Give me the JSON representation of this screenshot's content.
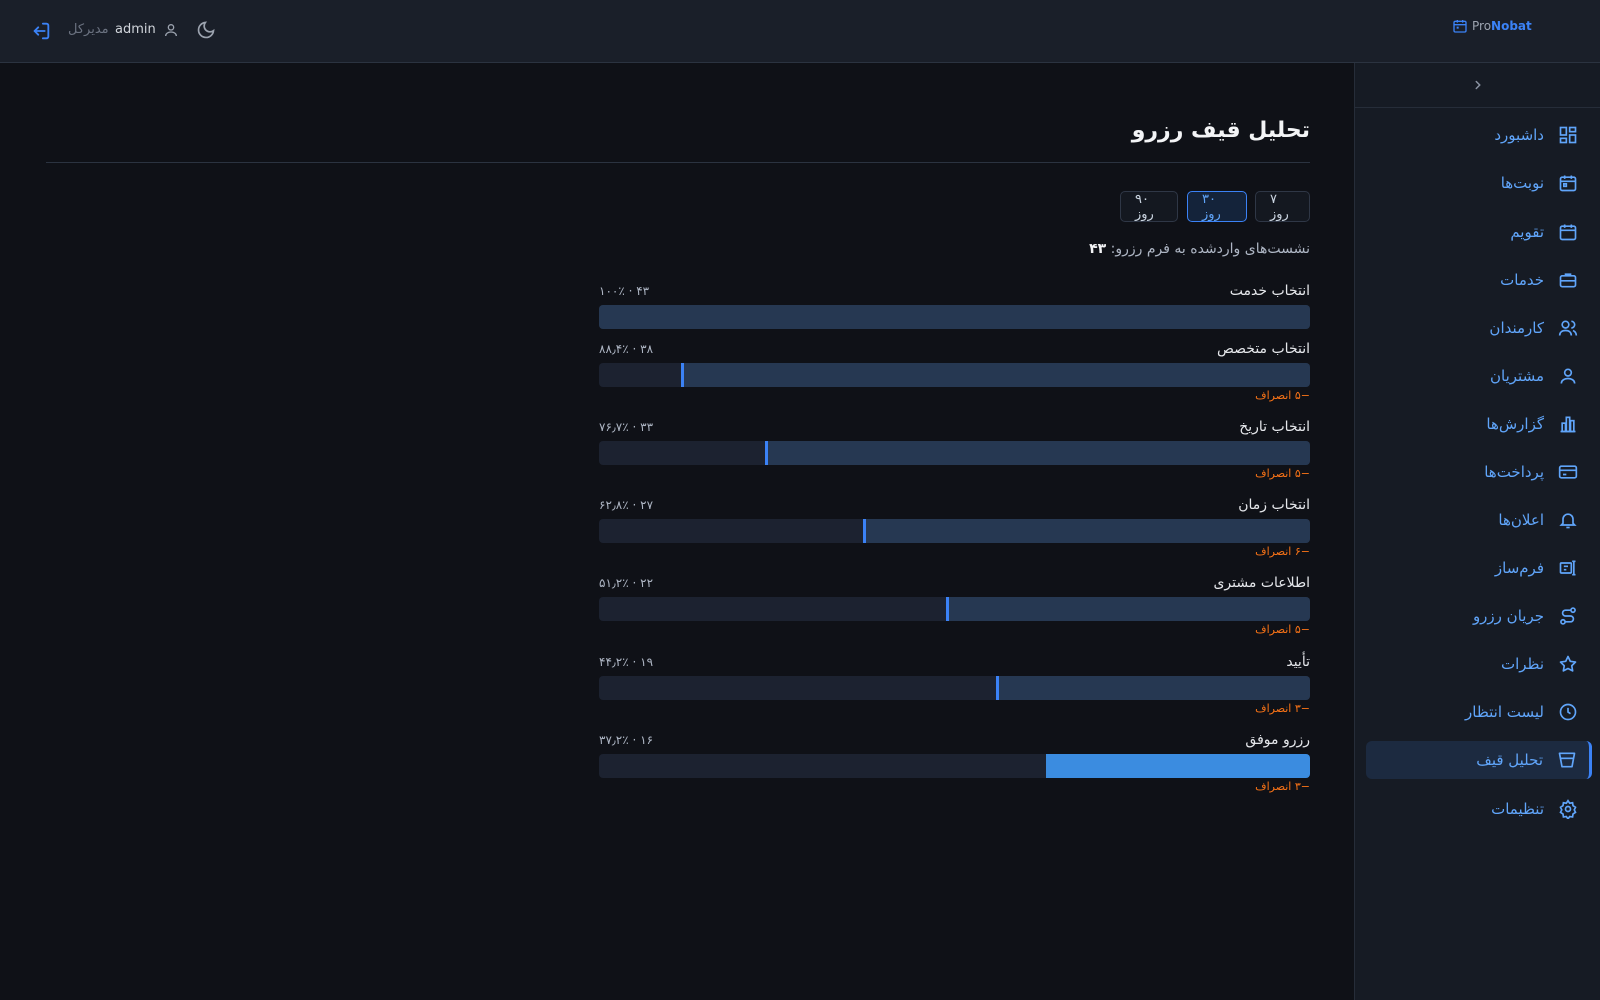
{
  "header": {
    "brand_prefix": "Pro",
    "brand_suffix": "Nobat",
    "user_name": "admin",
    "user_role": "مدیرکل"
  },
  "sidebar": {
    "items": [
      {
        "label": "داشبورد",
        "icon": "dashboard-grid-icon"
      },
      {
        "label": "نوبت‌ها",
        "icon": "calendar-icon"
      },
      {
        "label": "تقویم",
        "icon": "calendar-icon"
      },
      {
        "label": "خدمات",
        "icon": "briefcase-icon"
      },
      {
        "label": "کارمندان",
        "icon": "users-icon"
      },
      {
        "label": "مشتریان",
        "icon": "user-icon"
      },
      {
        "label": "گزارش‌ها",
        "icon": "bar-chart-icon"
      },
      {
        "label": "پرداخت‌ها",
        "icon": "credit-card-icon"
      },
      {
        "label": "اعلان‌ها",
        "icon": "bell-icon"
      },
      {
        "label": "فرم‌ساز",
        "icon": "form-builder-icon"
      },
      {
        "label": "جریان رزرو",
        "icon": "flow-icon"
      },
      {
        "label": "نظرات",
        "icon": "star-icon"
      },
      {
        "label": "لیست انتظار",
        "icon": "clock-icon"
      },
      {
        "label": "تحلیل قیف",
        "icon": "funnel-icon",
        "active": true
      },
      {
        "label": "تنظیمات",
        "icon": "gear-icon"
      }
    ]
  },
  "main": {
    "title": "تحلیل قیف رزرو",
    "ranges": [
      "۷ روز",
      "۳۰ روز",
      "۹۰ روز"
    ],
    "active_range": "۳۰ روز",
    "sessions_label": "نشست‌های واردشده به فرم رزرو:",
    "sessions_value": "۴۳",
    "steps": [
      {
        "label": "انتخاب خدمت",
        "stat": "۱۰۰٪ · ۴۳",
        "fraction": 1.0,
        "dropoff": ""
      },
      {
        "label": "انتخاب متخصص",
        "stat": "۸۸٫۴٪ · ۳۸",
        "fraction": 0.884,
        "dropoff": "−۵ انصراف"
      },
      {
        "label": "انتخاب تاریخ",
        "stat": "۷۶٫۷٪ · ۳۳",
        "fraction": 0.767,
        "dropoff": "−۵ انصراف"
      },
      {
        "label": "انتخاب زمان",
        "stat": "۶۲٫۸٪ · ۲۷",
        "fraction": 0.628,
        "dropoff": "−۶ انصراف"
      },
      {
        "label": "اطلاعات مشتری",
        "stat": "۵۱٫۲٪ · ۲۲",
        "fraction": 0.512,
        "dropoff": "−۵ انصراف"
      },
      {
        "label": "تأیید",
        "stat": "۴۴٫۲٪ · ۱۹",
        "fraction": 0.442,
        "dropoff": "−۳ انصراف"
      },
      {
        "label": "رزرو موفق",
        "stat": "۳۷٫۲٪ · ۱۶",
        "fraction": 0.372,
        "dropoff": "−۳ انصراف"
      }
    ]
  },
  "colors": {
    "accent": "#3b82f6",
    "dropoff": "#f97316",
    "background": "#0f1117"
  }
}
